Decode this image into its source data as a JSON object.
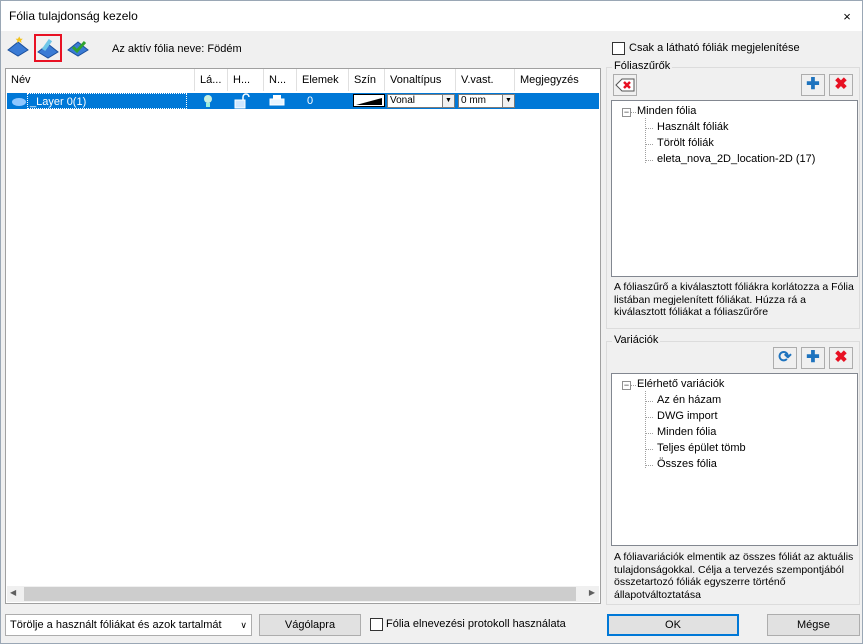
{
  "window": {
    "title": "Fólia tulajdonság kezelo",
    "close": "×"
  },
  "toolbar": {
    "active_label": "Az aktív fólia neve: Födém"
  },
  "grid": {
    "columns": [
      "Név",
      "Lá...",
      "H...",
      "N...",
      "Elemek",
      "Szín",
      "Vonaltípus",
      "V.vast.",
      "Megjegyzés"
    ],
    "rows": [
      {
        "name": "_Layer 0(1)",
        "elements": "0",
        "linetype": "Vonal",
        "width": "0 mm",
        "note": ""
      }
    ]
  },
  "right": {
    "only_visible_label": "Csak a látható fóliák megjelenítése",
    "filters": {
      "title": "Fóliaszűrők",
      "tree": [
        "Minden fólia",
        "Használt fóliák",
        "Törölt fóliák",
        "eleta_nova_2D_location-2D (17)"
      ],
      "description": "A fóliaszűrő a kiválasztott fóliákra korlátozza a Fólia listában megjelenített fóliákat. Húzza rá a kiválasztott fóliákat a fóliaszűrőre"
    },
    "variations": {
      "title": "Variációk",
      "tree": [
        "Elérhető variációk",
        "Az én házam",
        "DWG import",
        "Minden fólia",
        "Teljes épület tömb",
        "Összes fólia"
      ],
      "description": "A fóliavariációk elmentik az összes fóliát az aktuális tulajdonságokkal. Célja a tervezés szempontjából összetartozó fóliák egyszerre történő állapotváltoztatása"
    }
  },
  "bottom": {
    "delete_select": "Törölje a használt fóliákat és azok tartalmát",
    "clipboard_button": "Vágólapra",
    "protocol_label": "Fólia elnevezési protokoll használata",
    "ok_button": "OK",
    "cancel_button": "Mégse"
  },
  "colors": {
    "selection": "#0078d7",
    "accent_red": "#e81123",
    "accent_blue": "#1e73be"
  }
}
